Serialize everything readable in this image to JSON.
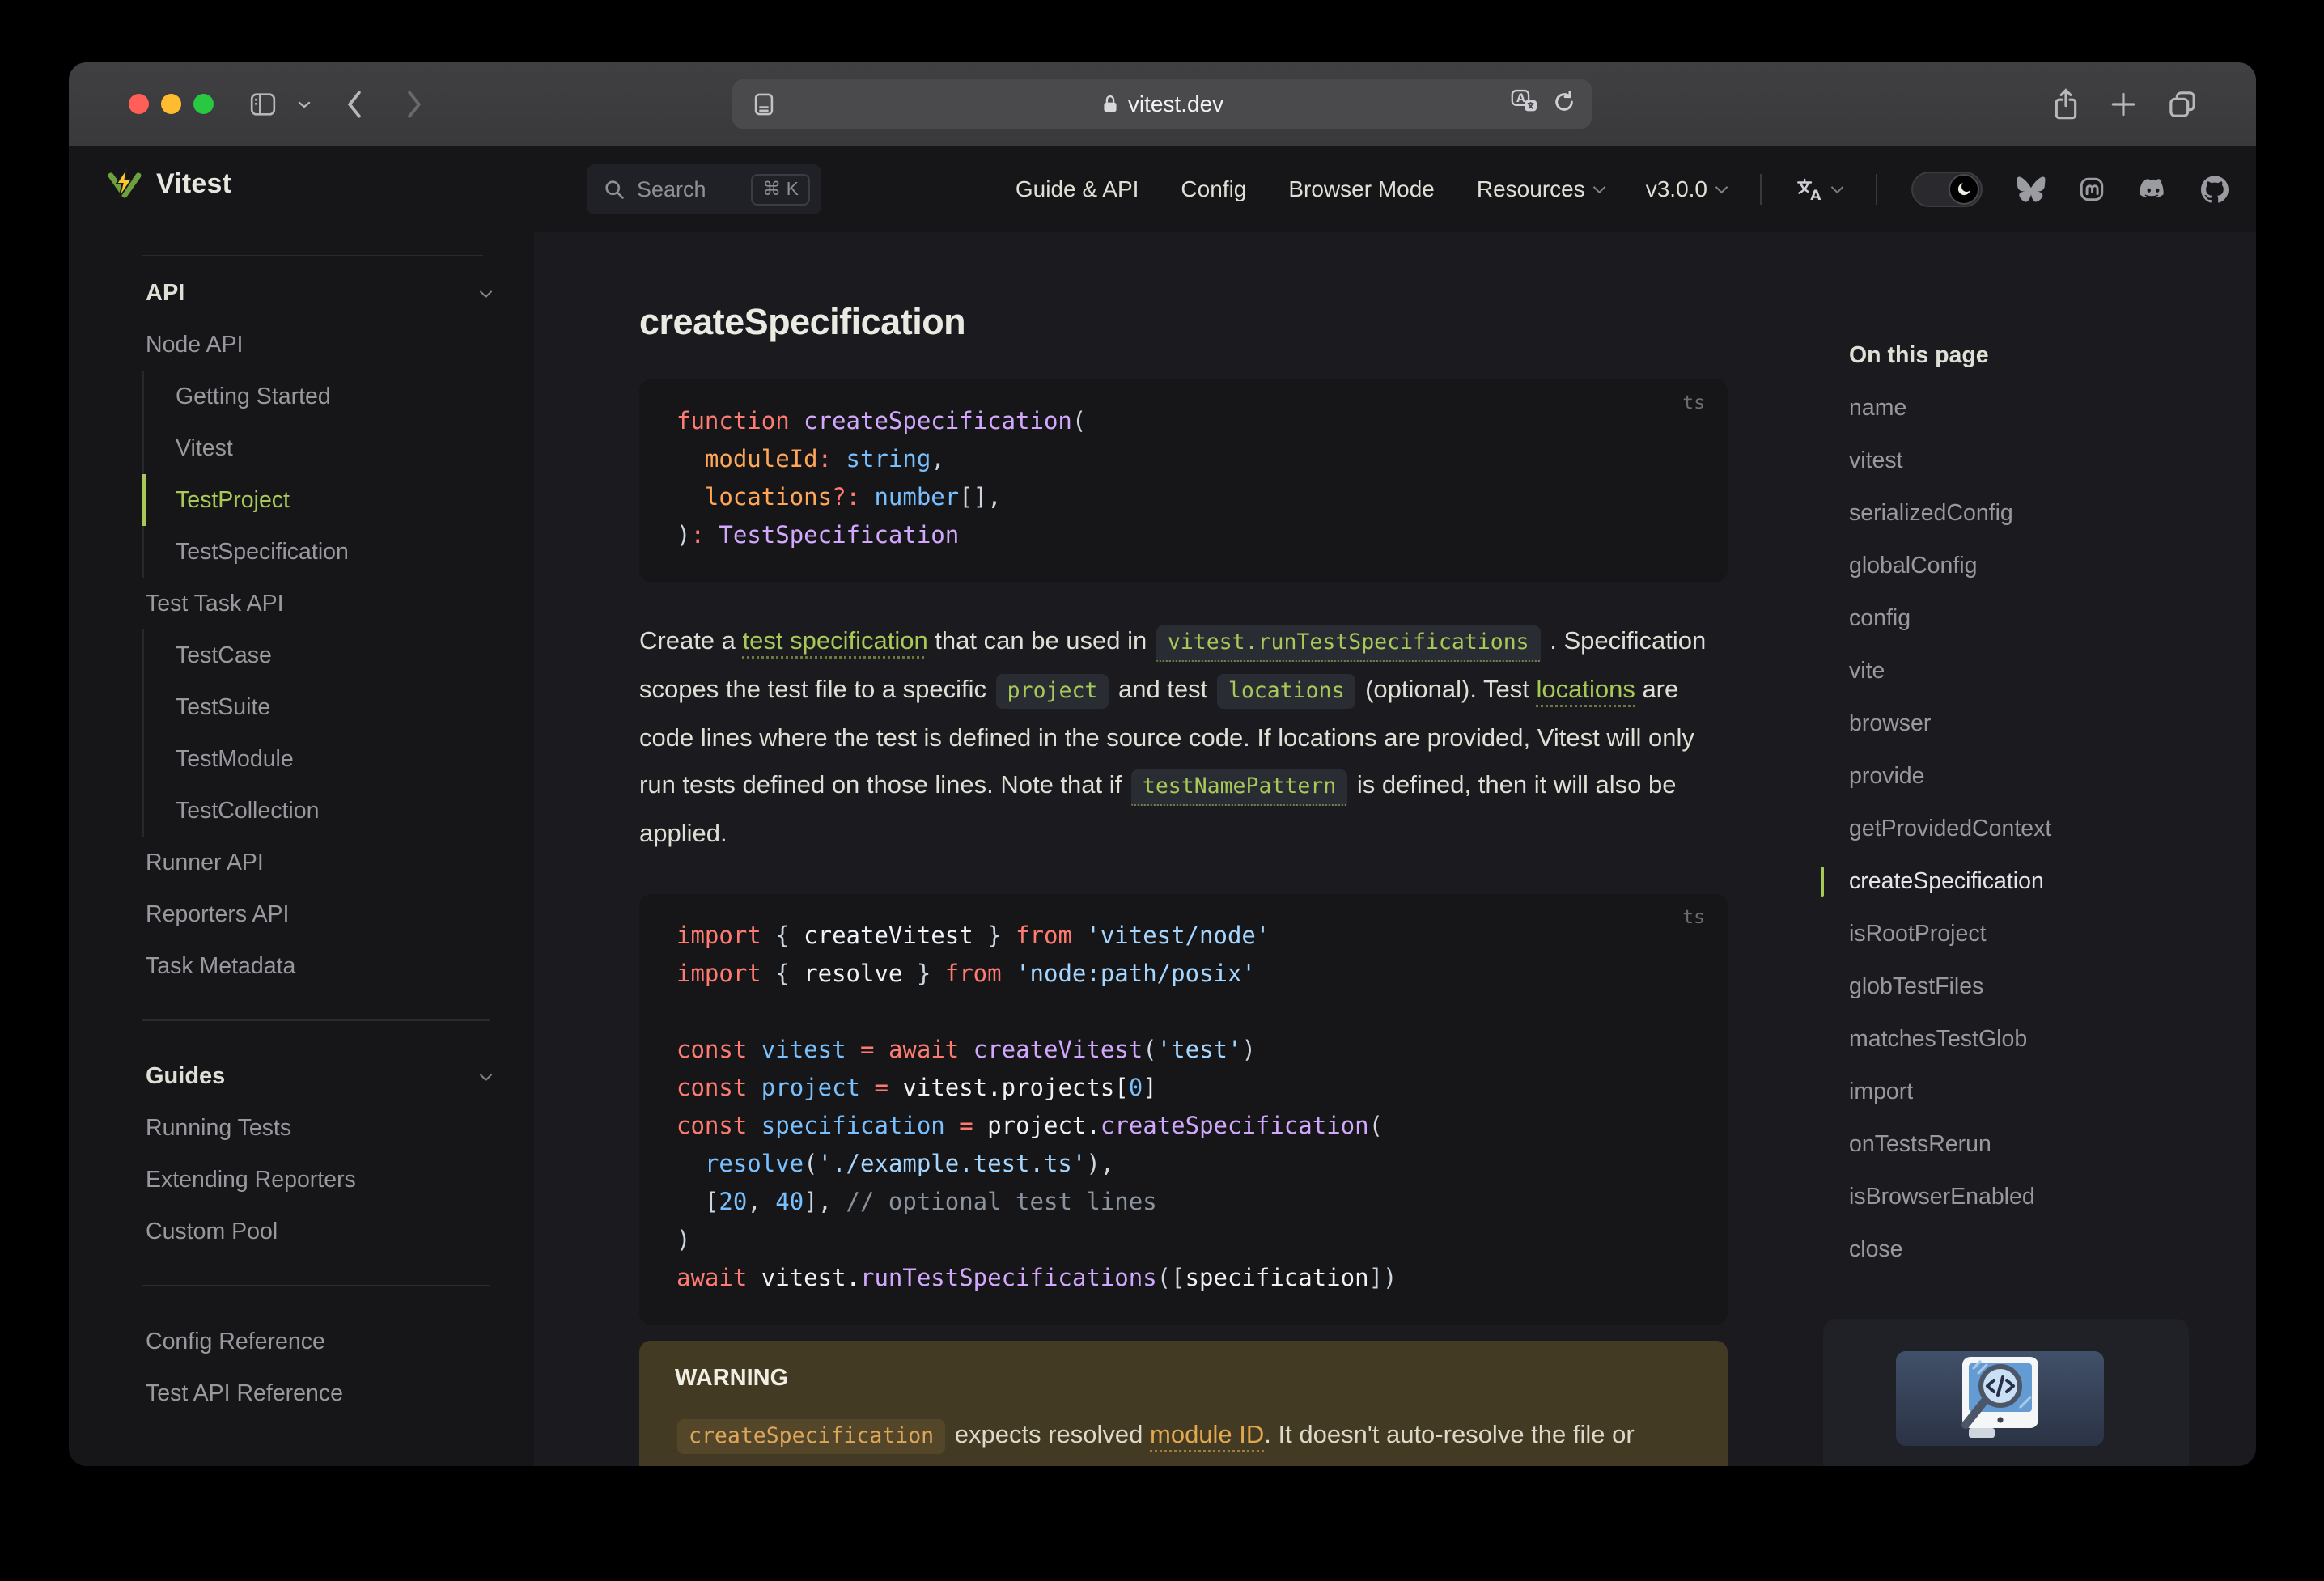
{
  "colors": {
    "brand_green": "#a7c957",
    "warning_bg": "#433a24",
    "warning_accent": "#e2a84e",
    "page_bg": "#1b1b1f",
    "panel_bg": "#161618",
    "code_token_colors": {
      "keyword": "#ff7b72",
      "function": "#d2a8ff",
      "variable": "#79c0ff",
      "string": "#a5d6ff",
      "parameter": "#ffa657",
      "comment": "#8b949e",
      "plain": "#eef1f5"
    }
  },
  "browser": {
    "url": "vitest.dev"
  },
  "header": {
    "logo_text": "Vitest",
    "search": {
      "label": "Search",
      "shortcut": "⌘ K"
    },
    "nav": [
      {
        "label": "Guide & API",
        "chevron": false
      },
      {
        "label": "Config",
        "chevron": false
      },
      {
        "label": "Browser Mode",
        "chevron": false
      },
      {
        "label": "Resources",
        "chevron": true
      },
      {
        "label": "v3.0.0",
        "chevron": true
      }
    ],
    "social_icons": [
      "bluesky-icon",
      "mastodon-icon",
      "discord-icon",
      "github-icon"
    ]
  },
  "sidebar": {
    "groups": [
      {
        "title": "API",
        "chevron": true,
        "items": [
          {
            "label": "Node API"
          },
          {
            "label": "Getting Started",
            "indent": true
          },
          {
            "label": "Vitest",
            "indent": true
          },
          {
            "label": "TestProject",
            "indent": true,
            "active": true
          },
          {
            "label": "TestSpecification",
            "indent": true
          },
          {
            "label": "Test Task API"
          },
          {
            "label": "TestCase",
            "indent": true
          },
          {
            "label": "TestSuite",
            "indent": true
          },
          {
            "label": "TestModule",
            "indent": true
          },
          {
            "label": "TestCollection",
            "indent": true
          },
          {
            "label": "Runner API"
          },
          {
            "label": "Reporters API"
          },
          {
            "label": "Task Metadata"
          }
        ]
      },
      {
        "title": "Guides",
        "chevron": true,
        "items": [
          {
            "label": "Running Tests"
          },
          {
            "label": "Extending Reporters"
          },
          {
            "label": "Custom Pool"
          }
        ]
      },
      {
        "title": null,
        "items": [
          {
            "label": "Config Reference"
          },
          {
            "label": "Test API Reference"
          }
        ]
      }
    ]
  },
  "main": {
    "title": "createSpecification",
    "code_blocks": [
      {
        "lang": "ts",
        "lines": [
          [
            [
              "k",
              "function "
            ],
            [
              "f",
              "createSpecification"
            ],
            [
              "p",
              "("
            ]
          ],
          [
            [
              "p",
              "  "
            ],
            [
              "o",
              "moduleId"
            ],
            [
              "k",
              ":"
            ],
            [
              "p",
              " "
            ],
            [
              "v",
              "string"
            ],
            [
              "p",
              ","
            ]
          ],
          [
            [
              "p",
              "  "
            ],
            [
              "o",
              "locations"
            ],
            [
              "k",
              "?:"
            ],
            [
              "p",
              " "
            ],
            [
              "v",
              "number"
            ],
            [
              "p",
              "[],"
            ]
          ],
          [
            [
              "p",
              ")"
            ],
            [
              "k",
              ":"
            ],
            [
              "p",
              " "
            ],
            [
              "f",
              "TestSpecification"
            ]
          ]
        ]
      },
      {
        "lang": "ts",
        "lines": [
          [
            [
              "k",
              "import"
            ],
            [
              "p",
              " { "
            ],
            [
              "w",
              "createVitest"
            ],
            [
              "p",
              " } "
            ],
            [
              "k",
              "from"
            ],
            [
              "p",
              " "
            ],
            [
              "s",
              "'vitest/node'"
            ]
          ],
          [
            [
              "k",
              "import"
            ],
            [
              "p",
              " { "
            ],
            [
              "w",
              "resolve"
            ],
            [
              "p",
              " } "
            ],
            [
              "k",
              "from"
            ],
            [
              "p",
              " "
            ],
            [
              "s",
              "'node:path/posix'"
            ]
          ],
          [],
          [
            [
              "k",
              "const"
            ],
            [
              "p",
              " "
            ],
            [
              "v",
              "vitest"
            ],
            [
              "p",
              " "
            ],
            [
              "k",
              "="
            ],
            [
              "p",
              " "
            ],
            [
              "k",
              "await"
            ],
            [
              "p",
              " "
            ],
            [
              "f",
              "createVitest"
            ],
            [
              "p",
              "("
            ],
            [
              "s",
              "'test'"
            ],
            [
              "p",
              ")"
            ]
          ],
          [
            [
              "k",
              "const"
            ],
            [
              "p",
              " "
            ],
            [
              "v",
              "project"
            ],
            [
              "p",
              " "
            ],
            [
              "k",
              "="
            ],
            [
              "p",
              " "
            ],
            [
              "w",
              "vitest.projects["
            ],
            [
              "n",
              "0"
            ],
            [
              "w",
              "]"
            ]
          ],
          [
            [
              "k",
              "const"
            ],
            [
              "p",
              " "
            ],
            [
              "v",
              "specification"
            ],
            [
              "p",
              " "
            ],
            [
              "k",
              "="
            ],
            [
              "p",
              " "
            ],
            [
              "w",
              "project."
            ],
            [
              "f",
              "createSpecification"
            ],
            [
              "p",
              "("
            ]
          ],
          [
            [
              "p",
              "  "
            ],
            [
              "v",
              "resolve"
            ],
            [
              "p",
              "("
            ],
            [
              "s",
              "'./example.test.ts'"
            ],
            [
              "p",
              "),"
            ]
          ],
          [
            [
              "p",
              "  ["
            ],
            [
              "n",
              "20"
            ],
            [
              "p",
              ", "
            ],
            [
              "n",
              "40"
            ],
            [
              "p",
              "], "
            ],
            [
              "c",
              "// optional test lines"
            ]
          ],
          [
            [
              "p",
              ")"
            ]
          ],
          [
            [
              "k",
              "await"
            ],
            [
              "p",
              " "
            ],
            [
              "w",
              "vitest."
            ],
            [
              "f",
              "runTestSpecifications"
            ],
            [
              "p",
              "(["
            ],
            [
              "w",
              "specification"
            ],
            [
              "p",
              "])"
            ]
          ]
        ]
      }
    ],
    "paragraph": [
      [
        "text",
        "Create a "
      ],
      [
        "link",
        "test specification"
      ],
      [
        "text",
        " that can be used in "
      ],
      [
        "codelink",
        "vitest.runTestSpecifications"
      ],
      [
        "text",
        " . Specification scopes the test file to a specific "
      ],
      [
        "code",
        "project"
      ],
      [
        "text",
        " and test "
      ],
      [
        "code",
        "locations"
      ],
      [
        "text",
        " (optional). Test "
      ],
      [
        "link",
        "locations"
      ],
      [
        "text",
        " are code lines where the test is defined in the source code. If locations are provided, Vitest will only run tests defined on those lines. Note that if "
      ],
      [
        "codelink",
        "testNamePattern"
      ],
      [
        "text",
        " is defined, then it will also be applied."
      ]
    ],
    "warning": {
      "title": "WARNING",
      "segments": [
        [
          "code",
          "createSpecification"
        ],
        [
          "text",
          " expects resolved "
        ],
        [
          "link",
          "module ID"
        ],
        [
          "text",
          ". It doesn't auto-resolve the file or check that it exists on the file system."
        ]
      ]
    }
  },
  "outline": {
    "title": "On this page",
    "items": [
      {
        "label": "name"
      },
      {
        "label": "vitest"
      },
      {
        "label": "serializedConfig"
      },
      {
        "label": "globalConfig"
      },
      {
        "label": "config"
      },
      {
        "label": "vite"
      },
      {
        "label": "browser"
      },
      {
        "label": "provide"
      },
      {
        "label": "getProvidedContext"
      },
      {
        "label": "createSpecification",
        "active": true
      },
      {
        "label": "isRootProject"
      },
      {
        "label": "globTestFiles"
      },
      {
        "label": "matchesTestGlob"
      },
      {
        "label": "import"
      },
      {
        "label": "onTestsRerun"
      },
      {
        "label": "isBrowserEnabled"
      },
      {
        "label": "close"
      }
    ]
  }
}
